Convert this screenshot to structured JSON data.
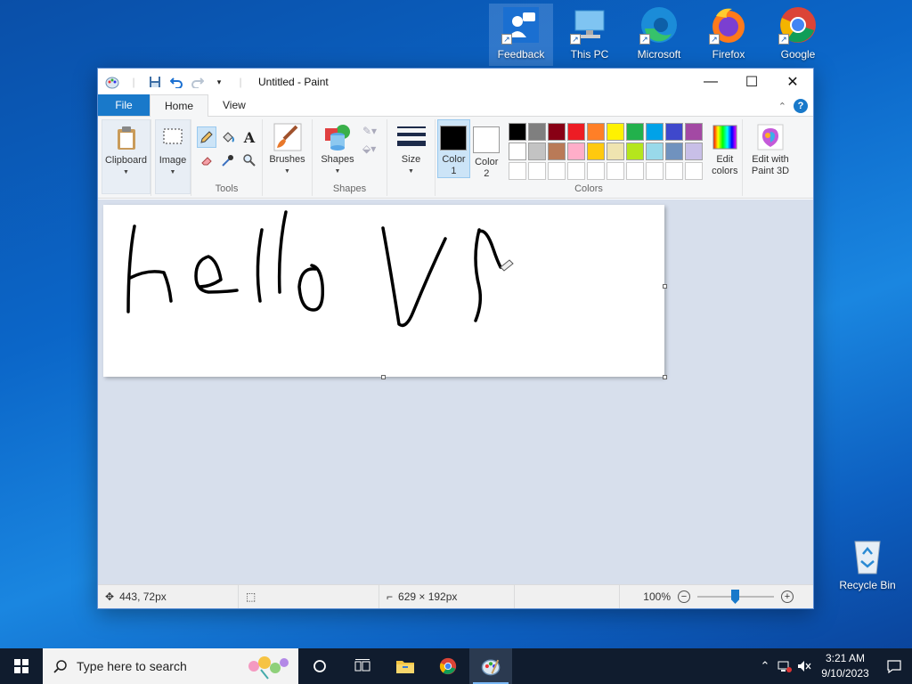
{
  "desktop": {
    "icons": [
      {
        "label": "Feedback",
        "icon": "feedback-hub-icon"
      },
      {
        "label": "This PC",
        "icon": "this-pc-icon"
      },
      {
        "label": "Microsoft",
        "icon": "edge-icon"
      },
      {
        "label": "Firefox",
        "icon": "firefox-icon"
      },
      {
        "label": "Google",
        "icon": "chrome-icon"
      },
      {
        "label": "Recycle Bin",
        "icon": "recycle-bin-icon"
      }
    ]
  },
  "window": {
    "title": "Untitled - Paint",
    "tabs": {
      "file": "File",
      "home": "Home",
      "view": "View"
    },
    "ribbon": {
      "clipboard": "Clipboard",
      "image": "Image",
      "tools_label": "Tools",
      "brushes": "Brushes",
      "shapes": "Shapes",
      "shapes_group": "Shapes",
      "size": "Size",
      "color1_a": "Color",
      "color1_b": "1",
      "color2_a": "Color",
      "color2_b": "2",
      "colors_group": "Colors",
      "edit_colors_a": "Edit",
      "edit_colors_b": "colors",
      "paint3d_a": "Edit with",
      "paint3d_b": "Paint 3D"
    },
    "colors": {
      "color1": "#000000",
      "color2": "#ffffff",
      "palette_row1": [
        "#000000",
        "#7f7f7f",
        "#880015",
        "#ed1c24",
        "#ff7f27",
        "#fff200",
        "#22b14c",
        "#00a2e8",
        "#3f48cc",
        "#a349a4"
      ],
      "palette_row2": [
        "#ffffff",
        "#c3c3c3",
        "#b97a57",
        "#ffaec9",
        "#ffc90e",
        "#efe4b0",
        "#b5e61d",
        "#99d9ea",
        "#7092be",
        "#c8bfe7"
      ]
    },
    "status": {
      "cursor_pos": "443, 72px",
      "canvas_size": "629 × 192px",
      "zoom": "100%"
    }
  },
  "taskbar": {
    "search_placeholder": "Type here to search",
    "time": "3:21 AM",
    "date": "9/10/2023"
  }
}
